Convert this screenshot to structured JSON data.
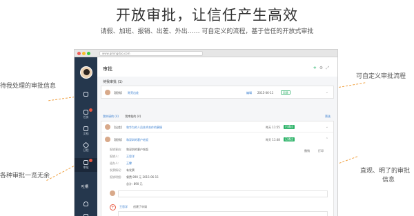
{
  "hero": {
    "title": "开放审批，让信任产生高效",
    "subtitle": "请假、加班、报销、出差、外出…… 可自定义的流程，基于信任的开放式审批"
  },
  "annotations": {
    "left_top": "待我处理的审批信息",
    "left_bottom": "各种审批一览无余",
    "right_top": "可自定义审批流程",
    "right_bottom_line1": "直观、明了的审批",
    "right_bottom_line2": "信息"
  },
  "browser": {
    "url": "www.qmingdao.com"
  },
  "sidebar": {
    "items": [
      {
        "label": "",
        "icon": "user-icon",
        "badge": false
      },
      {
        "label": "任务",
        "icon": "task-icon",
        "badge": true
      },
      {
        "label": "文档",
        "icon": "doc-icon",
        "badge": false
      },
      {
        "label": "日程",
        "icon": "calendar-icon",
        "badge": false
      },
      {
        "label": "审批",
        "icon": "approval-icon",
        "badge": true
      }
    ],
    "bottom_text": "吐槽"
  },
  "main": {
    "title": "审批",
    "pending_section": "待我审批 (1)",
    "pending": {
      "tag": "【报销】",
      "name": "陈亮出差",
      "link": "编辑",
      "date": "2015-06-11",
      "status": "同意"
    },
    "tabs": [
      "我申请的 (4)",
      "我审批的 (4)"
    ],
    "filter_label": "筛选",
    "list": [
      {
        "tag": "【出差】",
        "name": "和华为的人员技术合作的事情",
        "time": "昨天 11:55",
        "status": "已通过"
      },
      {
        "tag": "【报销】",
        "name": "和深圳的客户吃饭",
        "time": "昨天 11:48",
        "status": "已通过"
      }
    ],
    "detail": {
      "rows": [
        {
          "label": "报销事由:",
          "value": "和深圳的客户吃饭"
        },
        {
          "label": "报销人:",
          "value": "王思洋"
        },
        {
          "label": "经办人:",
          "value": "王霖"
        },
        {
          "label": "发票情况:",
          "value": "有发票"
        },
        {
          "label": "报销明细:",
          "value": "餐费  890 元   2015-06-15"
        },
        {
          "label": "",
          "value": "总计:  890 元"
        }
      ],
      "actions": [
        "撤销",
        "打印"
      ],
      "comment_author": "王思洋",
      "comment_text": "创建了申请"
    }
  }
}
